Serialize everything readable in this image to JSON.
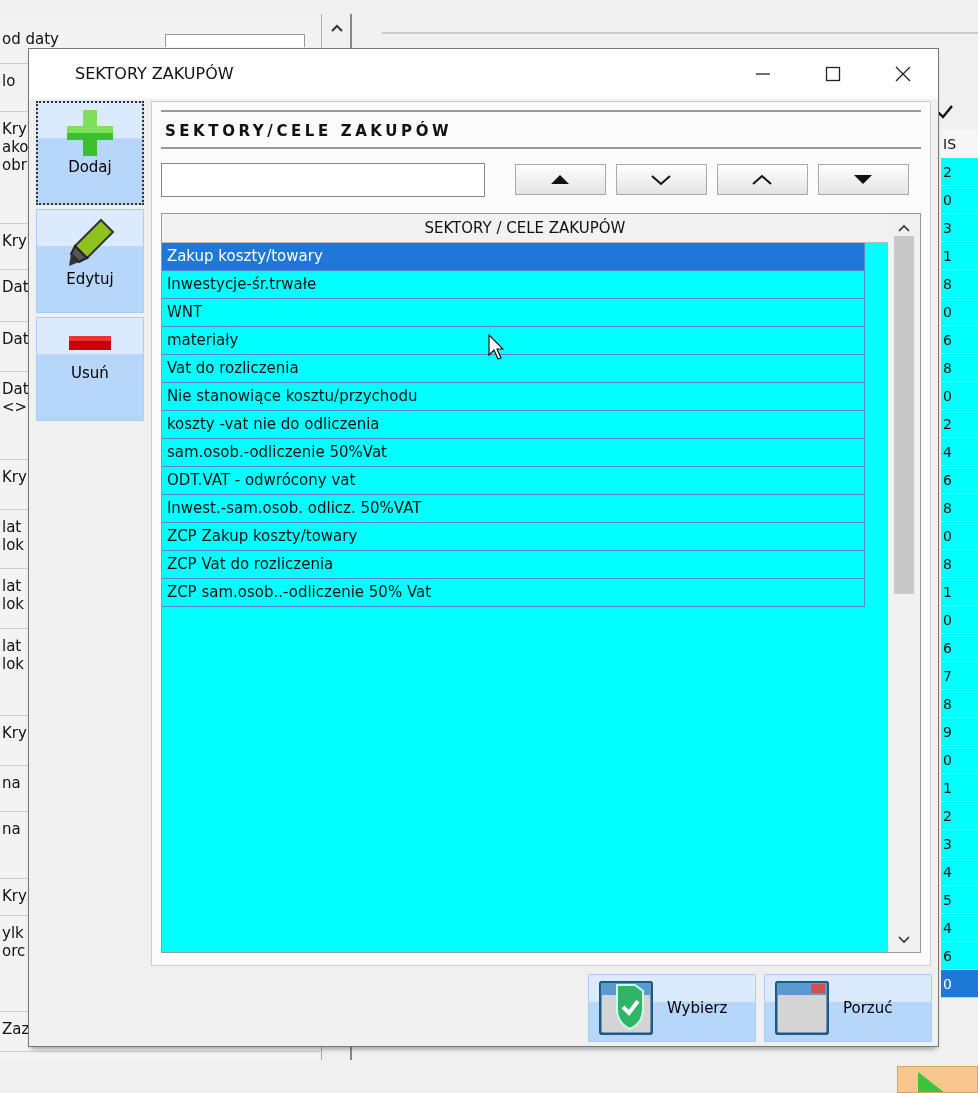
{
  "background": {
    "left_labels": [
      {
        "lines": [
          "od daty"
        ]
      },
      {
        "lines": [
          "lo"
        ]
      },
      {
        "lines": [
          "Kry",
          "ako",
          "obr"
        ]
      },
      {
        "lines": [
          "Kry"
        ]
      },
      {
        "lines": [
          "Dat"
        ]
      },
      {
        "lines": [
          "Dat"
        ]
      },
      {
        "lines": [
          "Dat",
          "<>"
        ]
      },
      {
        "lines": [
          "Kry"
        ]
      },
      {
        "lines": [
          "lat",
          "lok"
        ]
      },
      {
        "lines": [
          "lat",
          "lok"
        ]
      },
      {
        "lines": [
          "lat",
          "lok"
        ]
      },
      {
        "lines": [
          "Kry"
        ]
      },
      {
        "lines": [
          "na"
        ]
      },
      {
        "lines": [
          "na"
        ]
      },
      {
        "lines": [
          "Kry"
        ]
      },
      {
        "lines": [
          "ylk",
          "orc"
        ]
      },
      {
        "lines": [
          "Zaz"
        ]
      }
    ],
    "column_header": "IS",
    "column_cells": [
      {
        "text": "2",
        "selected": false
      },
      {
        "text": "0",
        "selected": false
      },
      {
        "text": "3",
        "selected": false
      },
      {
        "text": "1",
        "selected": false
      },
      {
        "text": "8",
        "selected": false
      },
      {
        "text": "0",
        "selected": false
      },
      {
        "text": "6",
        "selected": false
      },
      {
        "text": "8",
        "selected": false
      },
      {
        "text": "0",
        "selected": false
      },
      {
        "text": "2",
        "selected": false
      },
      {
        "text": "4",
        "selected": false
      },
      {
        "text": "6",
        "selected": false
      },
      {
        "text": "8",
        "selected": false
      },
      {
        "text": "0",
        "selected": false
      },
      {
        "text": "8",
        "selected": false
      },
      {
        "text": "1",
        "selected": false
      },
      {
        "text": "0",
        "selected": false
      },
      {
        "text": "6",
        "selected": false
      },
      {
        "text": "7",
        "selected": false
      },
      {
        "text": "8",
        "selected": false
      },
      {
        "text": "9",
        "selected": false
      },
      {
        "text": "0",
        "selected": false
      },
      {
        "text": "1",
        "selected": false
      },
      {
        "text": "2",
        "selected": false
      },
      {
        "text": "3",
        "selected": false
      },
      {
        "text": "4",
        "selected": false
      },
      {
        "text": "5",
        "selected": false
      },
      {
        "text": "4",
        "selected": false
      },
      {
        "text": "6",
        "selected": false
      },
      {
        "text": "0",
        "selected": true
      }
    ]
  },
  "dialog": {
    "title": "SEKTORY ZAKUPÓW",
    "side_buttons": [
      {
        "label": "Dodaj",
        "kind": "add",
        "focused": true
      },
      {
        "label": "Edytuj",
        "kind": "edit",
        "focused": false
      },
      {
        "label": "Usuń",
        "kind": "delete",
        "focused": false
      }
    ],
    "heading": "SEKTORY/CELE ZAKUPÓW",
    "nav_buttons": [
      {
        "kind": "first"
      },
      {
        "kind": "next"
      },
      {
        "kind": "prev"
      },
      {
        "kind": "last"
      }
    ],
    "grid": {
      "column": "SEKTORY / CELE  ZAKUPÓW",
      "rows": [
        {
          "text": "Zakup koszty/towary",
          "selected": true
        },
        {
          "text": "Inwestycje-śr.trwałe",
          "selected": false
        },
        {
          "text": "WNT",
          "selected": false
        },
        {
          "text": "materiały",
          "selected": false
        },
        {
          "text": "Vat do rozliczenia",
          "selected": false
        },
        {
          "text": "Nie stanowiące kosztu/przychodu",
          "selected": false
        },
        {
          "text": "koszty -vat nie do odliczenia",
          "selected": false
        },
        {
          "text": "sam.osob.-odliczenie 50%Vat",
          "selected": false
        },
        {
          "text": "ODT.VAT - odwrócony vat",
          "selected": false
        },
        {
          "text": "Inwest.-sam.osob. odlicz. 50%VAT",
          "selected": false
        },
        {
          "text": "ZCP Zakup koszty/towary",
          "selected": false
        },
        {
          "text": "ZCP Vat do rozliczenia",
          "selected": false
        },
        {
          "text": "ZCP sam.osob..-odliczenie 50% Vat",
          "selected": false
        }
      ]
    },
    "buttons": [
      {
        "label": "Wybierz",
        "kind": "ok"
      },
      {
        "label": "Porzuć",
        "kind": "cancel"
      }
    ]
  }
}
